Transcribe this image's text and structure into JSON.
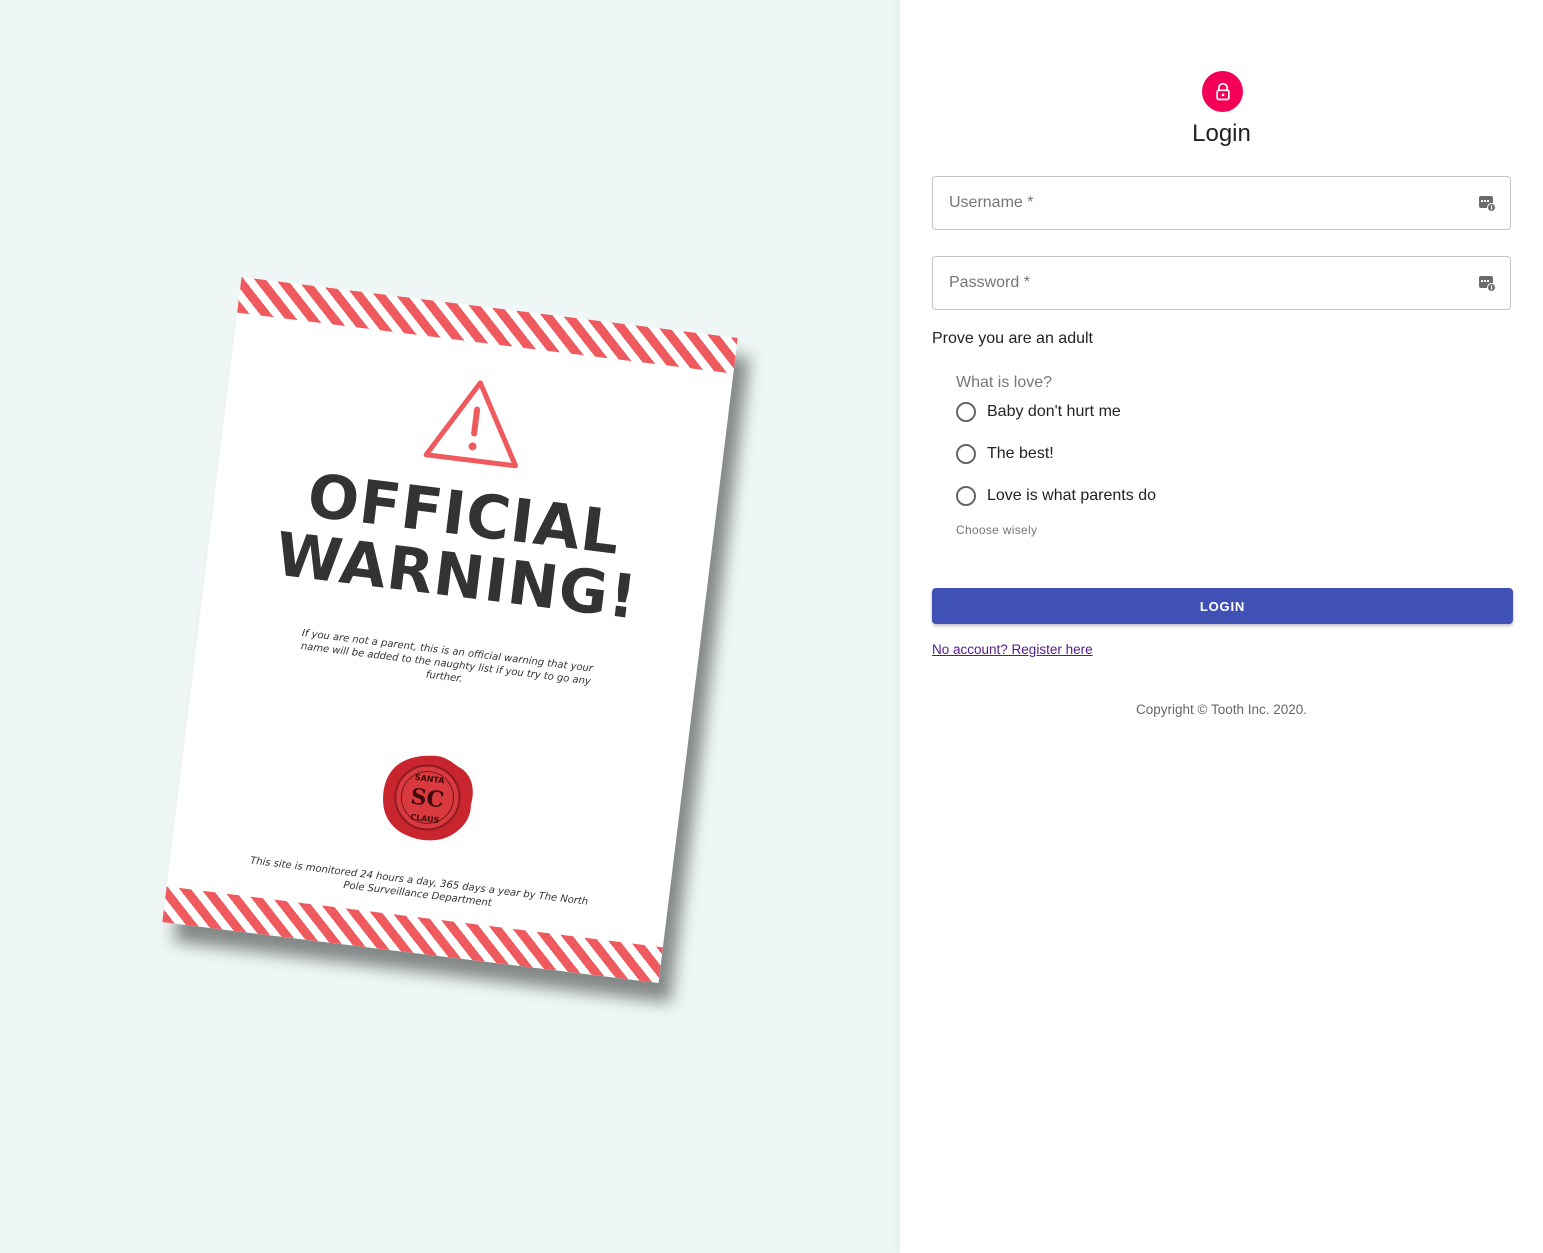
{
  "poster": {
    "title_line1": "OFFICIAL",
    "title_line2": "WARNING!",
    "body_text": "If you are not a parent, this is an official warning that your name will be added to the naughty list if you try to go any further.",
    "seal_text_top": "SANTA",
    "seal_monogram": "SC",
    "seal_text_bottom": "CLAUS",
    "footer_text": "This site is monitored 24 hours a day, 365 days a year by The North Pole Surveillance Department",
    "stripe_color": "#ef5a5f"
  },
  "login": {
    "title": "Login",
    "avatar_icon": "lock-icon",
    "avatar_color": "#f50057",
    "username_placeholder": "Username *",
    "username_value": "",
    "password_placeholder": "Password *",
    "password_value": "",
    "prove_label": "Prove you are an adult",
    "question_legend": "What is love?",
    "options": [
      {
        "label": "Baby don't hurt me",
        "selected": false
      },
      {
        "label": "The best!",
        "selected": false
      },
      {
        "label": "Love is what parents do",
        "selected": false
      }
    ],
    "helper_text": "Choose wisely",
    "button_label": "LOGIN",
    "button_color": "#3f51b5",
    "register_link": "No account? Register here",
    "copyright": "Copyright © Tooth Inc. 2020."
  }
}
